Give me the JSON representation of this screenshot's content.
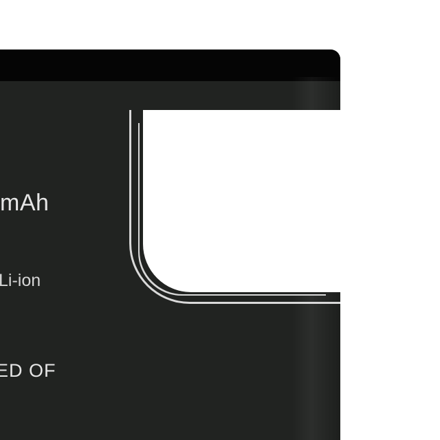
{
  "image": {
    "subject": "battery-closeup",
    "colors": {
      "body": "#212321",
      "top_cap": "#050505",
      "label_window": "#ffffff",
      "outline": "#d9d9d9",
      "text": "#e6e6e6",
      "background": "#ffffff"
    }
  },
  "battery_text": {
    "capacity_fragment": "mAh",
    "chemistry_fragment": "Li-ion",
    "made_fragment": "ED OF"
  }
}
